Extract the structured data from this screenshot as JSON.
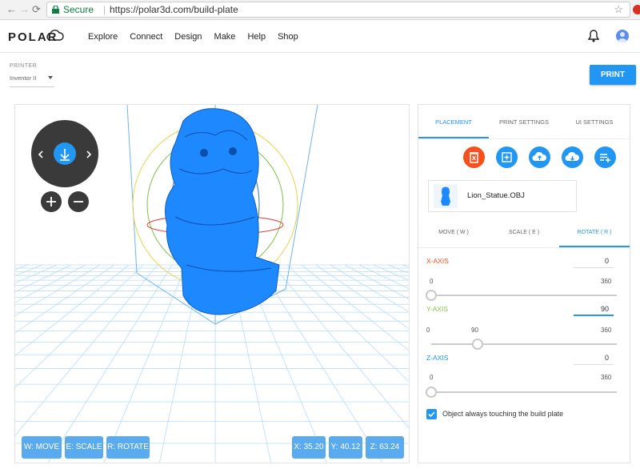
{
  "browser": {
    "secure_label": "Secure",
    "url": "https://polar3d.com/build-plate"
  },
  "header": {
    "logo_text": "POLAR",
    "nav": [
      "Explore",
      "Connect",
      "Design",
      "Make",
      "Help",
      "Shop"
    ]
  },
  "printer": {
    "label": "PRINTER",
    "value": "Inventor II"
  },
  "print_button": "PRINT",
  "viewport": {
    "bottom_buttons": [
      "W: MOVE",
      "E: SCALE",
      "R: ROTATE"
    ],
    "coords": {
      "x": "X: 35.20",
      "y": "Y: 40.12",
      "z": "Z: 63.24"
    },
    "model_color": "#1e88ff"
  },
  "panel": {
    "tabs": [
      "PLACEMENT",
      "PRINT SETTINGS",
      "UI SETTINGS"
    ],
    "active_tab": "PLACEMENT",
    "actions": [
      "delete-icon",
      "add-object-icon",
      "upload-icon",
      "download-icon",
      "playlist-add-icon"
    ],
    "file_name": "Lion_Statue.OBJ",
    "subtabs": [
      "MOVE ( W )",
      "SCALE ( E )",
      "ROTATE ( R )"
    ],
    "active_subtab": "ROTATE ( R )",
    "rotate": {
      "x": {
        "label": "X-AXIS",
        "value": "0",
        "min": "0",
        "max": "360",
        "fraction": 0.0,
        "color": "#f4511e"
      },
      "y": {
        "label": "Y-AXIS",
        "value": "90",
        "min": "0",
        "mid": "90",
        "max": "360",
        "fraction": 0.25,
        "color": "#8bc34a"
      },
      "z": {
        "label": "Z-AXIS",
        "value": "0",
        "min": "0",
        "max": "360",
        "fraction": 0.0,
        "color": "#2196f3"
      }
    },
    "checkbox_label": "Object always touching the build plate",
    "checkbox_checked": true
  }
}
